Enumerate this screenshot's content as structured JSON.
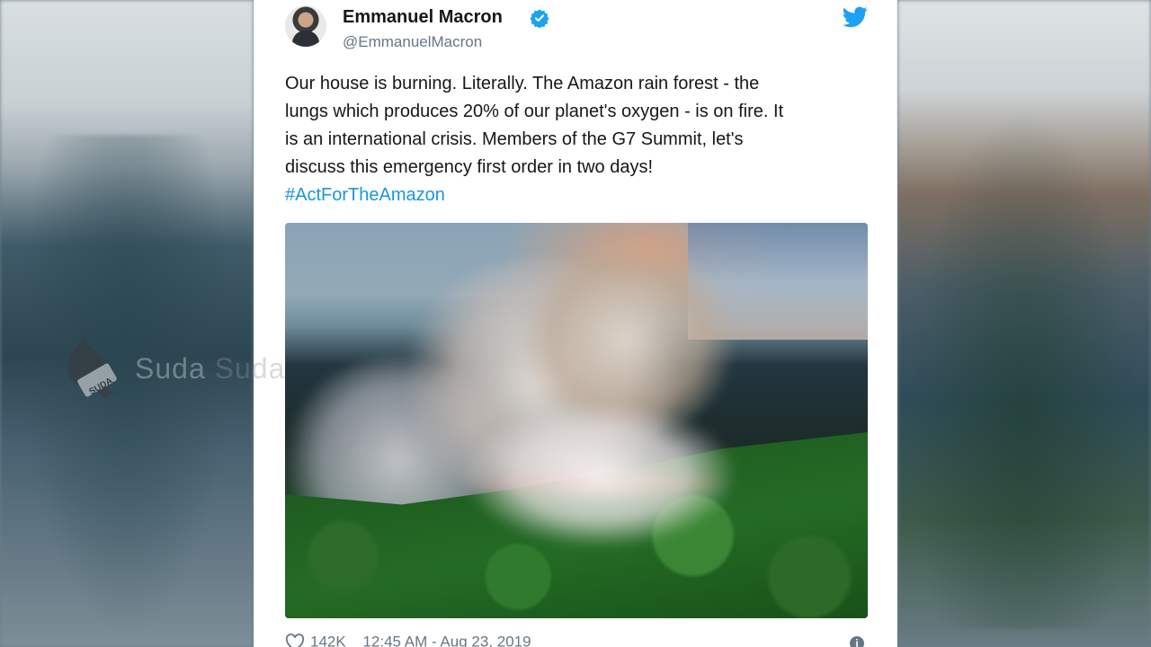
{
  "tweet": {
    "author_name": "Emmanuel Macron",
    "handle": "@EmmanuelMacron",
    "text_lines": [
      "Our house is burning. Literally. The Amazon rain forest - the",
      "lungs which produces 20% of our planet's oxygen - is on fire. It",
      "is an international crisis. Members of the G7 Summit, let's",
      "discuss this emergency first order in two days!"
    ],
    "hashtag": "#ActForTheAmazon",
    "likes": "142K",
    "timestamp": "12:45 AM - Aug 23, 2019"
  },
  "watermark": {
    "text": "Suda",
    "text_tail": "Suda",
    "logo_text": "SUDA"
  },
  "colors": {
    "verified_blue": "#1da1f2",
    "twitter_blue": "#1da1f2",
    "hashtag_blue": "#1b95e0",
    "secondary_text": "#657786"
  },
  "icons": [
    "verified-badge-icon",
    "twitter-bird-icon",
    "heart-icon",
    "info-icon"
  ]
}
